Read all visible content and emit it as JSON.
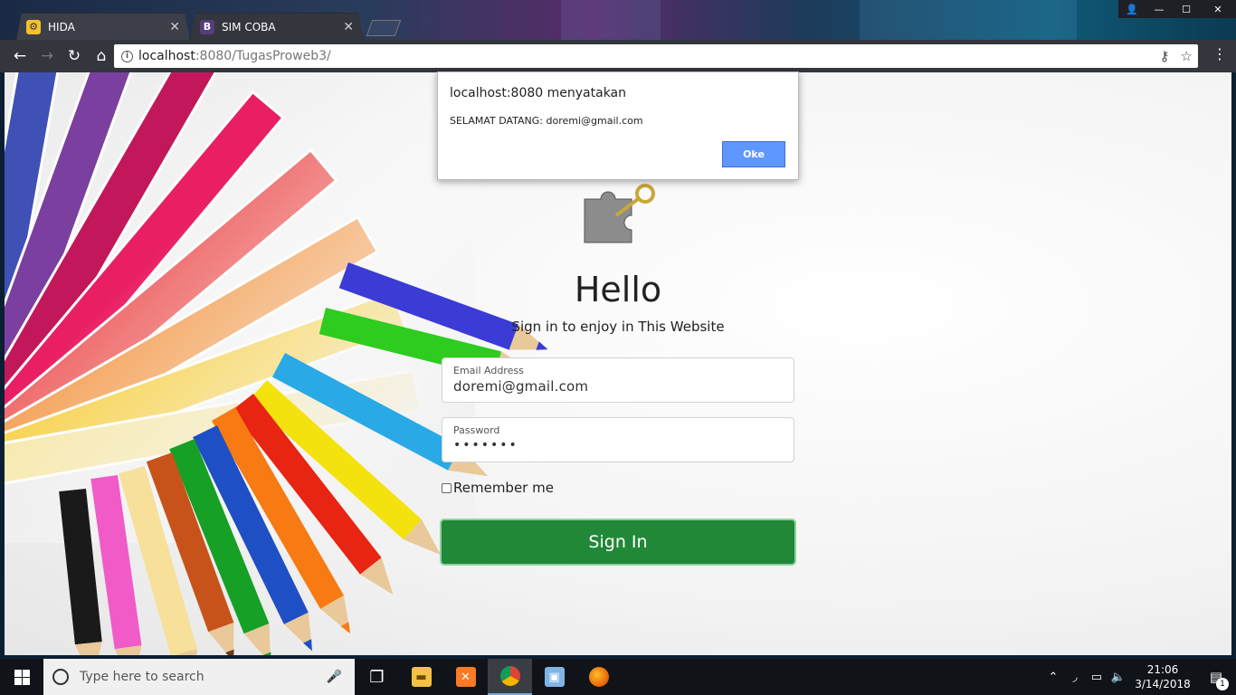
{
  "browser": {
    "tabs": [
      {
        "title": "HIDA",
        "favicon": "hida-favicon"
      },
      {
        "title": "SIM COBA",
        "favicon": "bootstrap-favicon"
      }
    ],
    "url_host": "localhost",
    "url_rest": ":8080/TugasProweb3/"
  },
  "page": {
    "heading": "Hello",
    "subheading": "Sign in to enjoy in This Website",
    "email_label": "Email Address",
    "email_value": "doremi@gmail.com",
    "password_label": "Password",
    "password_value": "•••••••",
    "remember_label": "Remember me",
    "signin_label": "Sign In",
    "signin_color": "#218838"
  },
  "alert": {
    "title": "localhost:8080 menyatakan",
    "message": "SELAMAT DATANG: doremi@gmail.com",
    "ok_label": "Oke"
  },
  "taskbar": {
    "search_placeholder": "Type here to search",
    "apps": [
      "task-view-icon",
      "file-explorer-icon",
      "xampp-icon",
      "chrome-icon",
      "virtualbox-icon",
      "firefox-icon"
    ],
    "time": "21:06",
    "date": "3/14/2018",
    "notification_count": "1"
  }
}
